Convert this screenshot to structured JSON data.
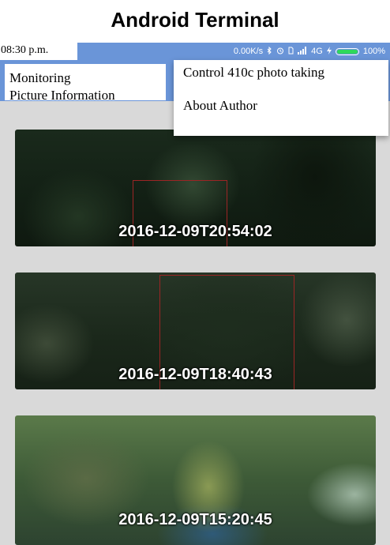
{
  "figure_title": "Android Terminal",
  "status_bar": {
    "time": "08:30 p.m.",
    "network_speed": "0.00K/s",
    "bluetooth_icon": "bluetooth-icon",
    "alarm_icon": "alarm-icon",
    "sim_icon": "sim-icon",
    "signal_icon": "signal-icon",
    "network_type": "4G",
    "charging_icon": "charging-icon",
    "battery_percent": "100%",
    "battery_level": 1.0
  },
  "tabs": [
    {
      "label": "Monitoring"
    },
    {
      "label": "Picture Information"
    }
  ],
  "overflow_menu": {
    "items": [
      {
        "label": "Control 410c photo taking"
      },
      {
        "label": "About Author"
      }
    ]
  },
  "photos": [
    {
      "timestamp": "2016-12-09T20:54:02"
    },
    {
      "timestamp": "2016-12-09T18:40:43"
    },
    {
      "timestamp": "2016-12-09T15:20:45"
    }
  ],
  "colors": {
    "action_bar": "#6a95d8",
    "screen_background": "#d9d9d9",
    "battery_fill": "#2fd85a",
    "detection_box": "#9c2525"
  }
}
